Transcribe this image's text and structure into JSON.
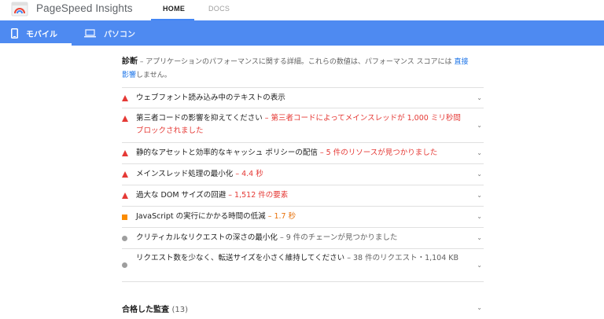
{
  "header": {
    "brand": "PageSpeed Insights",
    "tabs": [
      {
        "label": "HOME"
      },
      {
        "label": "DOCS"
      }
    ]
  },
  "device_tabs": [
    {
      "label": "モバイル",
      "icon": "mobile-icon"
    },
    {
      "label": "パソコン",
      "icon": "laptop-icon"
    }
  ],
  "diagnostics": {
    "title": "診断",
    "desc": "– アプリケーションのパフォーマンスに関する詳細。これらの数値は、パフォーマンス スコアには",
    "link1": "直接",
    "link2": "影響",
    "desc_end": "しません。"
  },
  "audits": [
    {
      "severity": "fail",
      "title": "ウェブフォント読み込み中のテキストの表示",
      "detail": ""
    },
    {
      "severity": "fail",
      "title": "第三者コードの影響を抑えてください",
      "detail": "– 第三者コードによってメインスレッドが 1,000 ミリ秒間ブロックされました"
    },
    {
      "severity": "fail",
      "title": "静的なアセットと効率的なキャッシュ ポリシーの配信",
      "detail": "– 5 件のリソースが見つかりました"
    },
    {
      "severity": "fail",
      "title": "メインスレッド処理の最小化",
      "detail": "– 4.4 秒"
    },
    {
      "severity": "fail",
      "title": "過大な DOM サイズの回避",
      "detail": "– 1,512 件の要素"
    },
    {
      "severity": "average",
      "title": "JavaScript の実行にかかる時間の低減",
      "detail": "– 1.7 秒"
    },
    {
      "severity": "info",
      "title": "クリティカルなリクエストの深さの最小化",
      "detail": "– 9 件のチェーンが見つかりました"
    },
    {
      "severity": "info",
      "title": "リクエスト数を少なく、転送サイズを小さく維持してください",
      "detail": "– 38 件のリクエスト・1,104 KB"
    }
  ],
  "passed": {
    "title": "合格した監査",
    "count": "(13)"
  },
  "colors": {
    "accent": "#4e8af1",
    "fail": "#e53935",
    "average": "#e8710a",
    "info": "#9e9e9e"
  }
}
